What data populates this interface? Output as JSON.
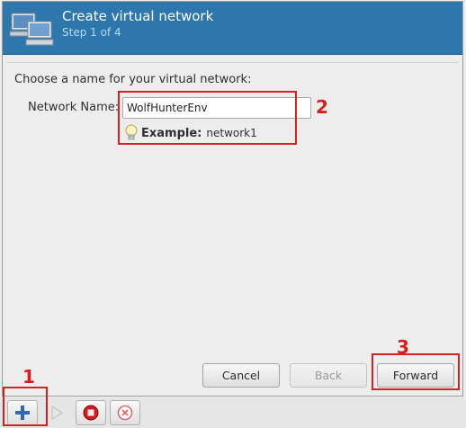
{
  "header": {
    "title": "Create virtual network",
    "subtitle": "Step 1 of 4",
    "icon": "network-computers-icon"
  },
  "form": {
    "prompt": "Choose a name for your virtual network:",
    "name_label": "Network Name:",
    "name_value": "WolfHunterEnv",
    "hint_label": "Example:",
    "hint_value": "network1",
    "hint_icon": "lightbulb-icon"
  },
  "buttons": {
    "cancel": "Cancel",
    "back": "Back",
    "forward": "Forward"
  },
  "toolbar": {
    "add_icon": "plus-icon",
    "start_icon": "play-icon",
    "stop_icon": "stop-icon",
    "delete_icon": "delete-icon"
  },
  "annotations": {
    "one": "1",
    "two": "2",
    "three": "3",
    "color": "#d22222"
  },
  "colors": {
    "header_bg": "#2d77ad",
    "annotation": "#d22222"
  }
}
